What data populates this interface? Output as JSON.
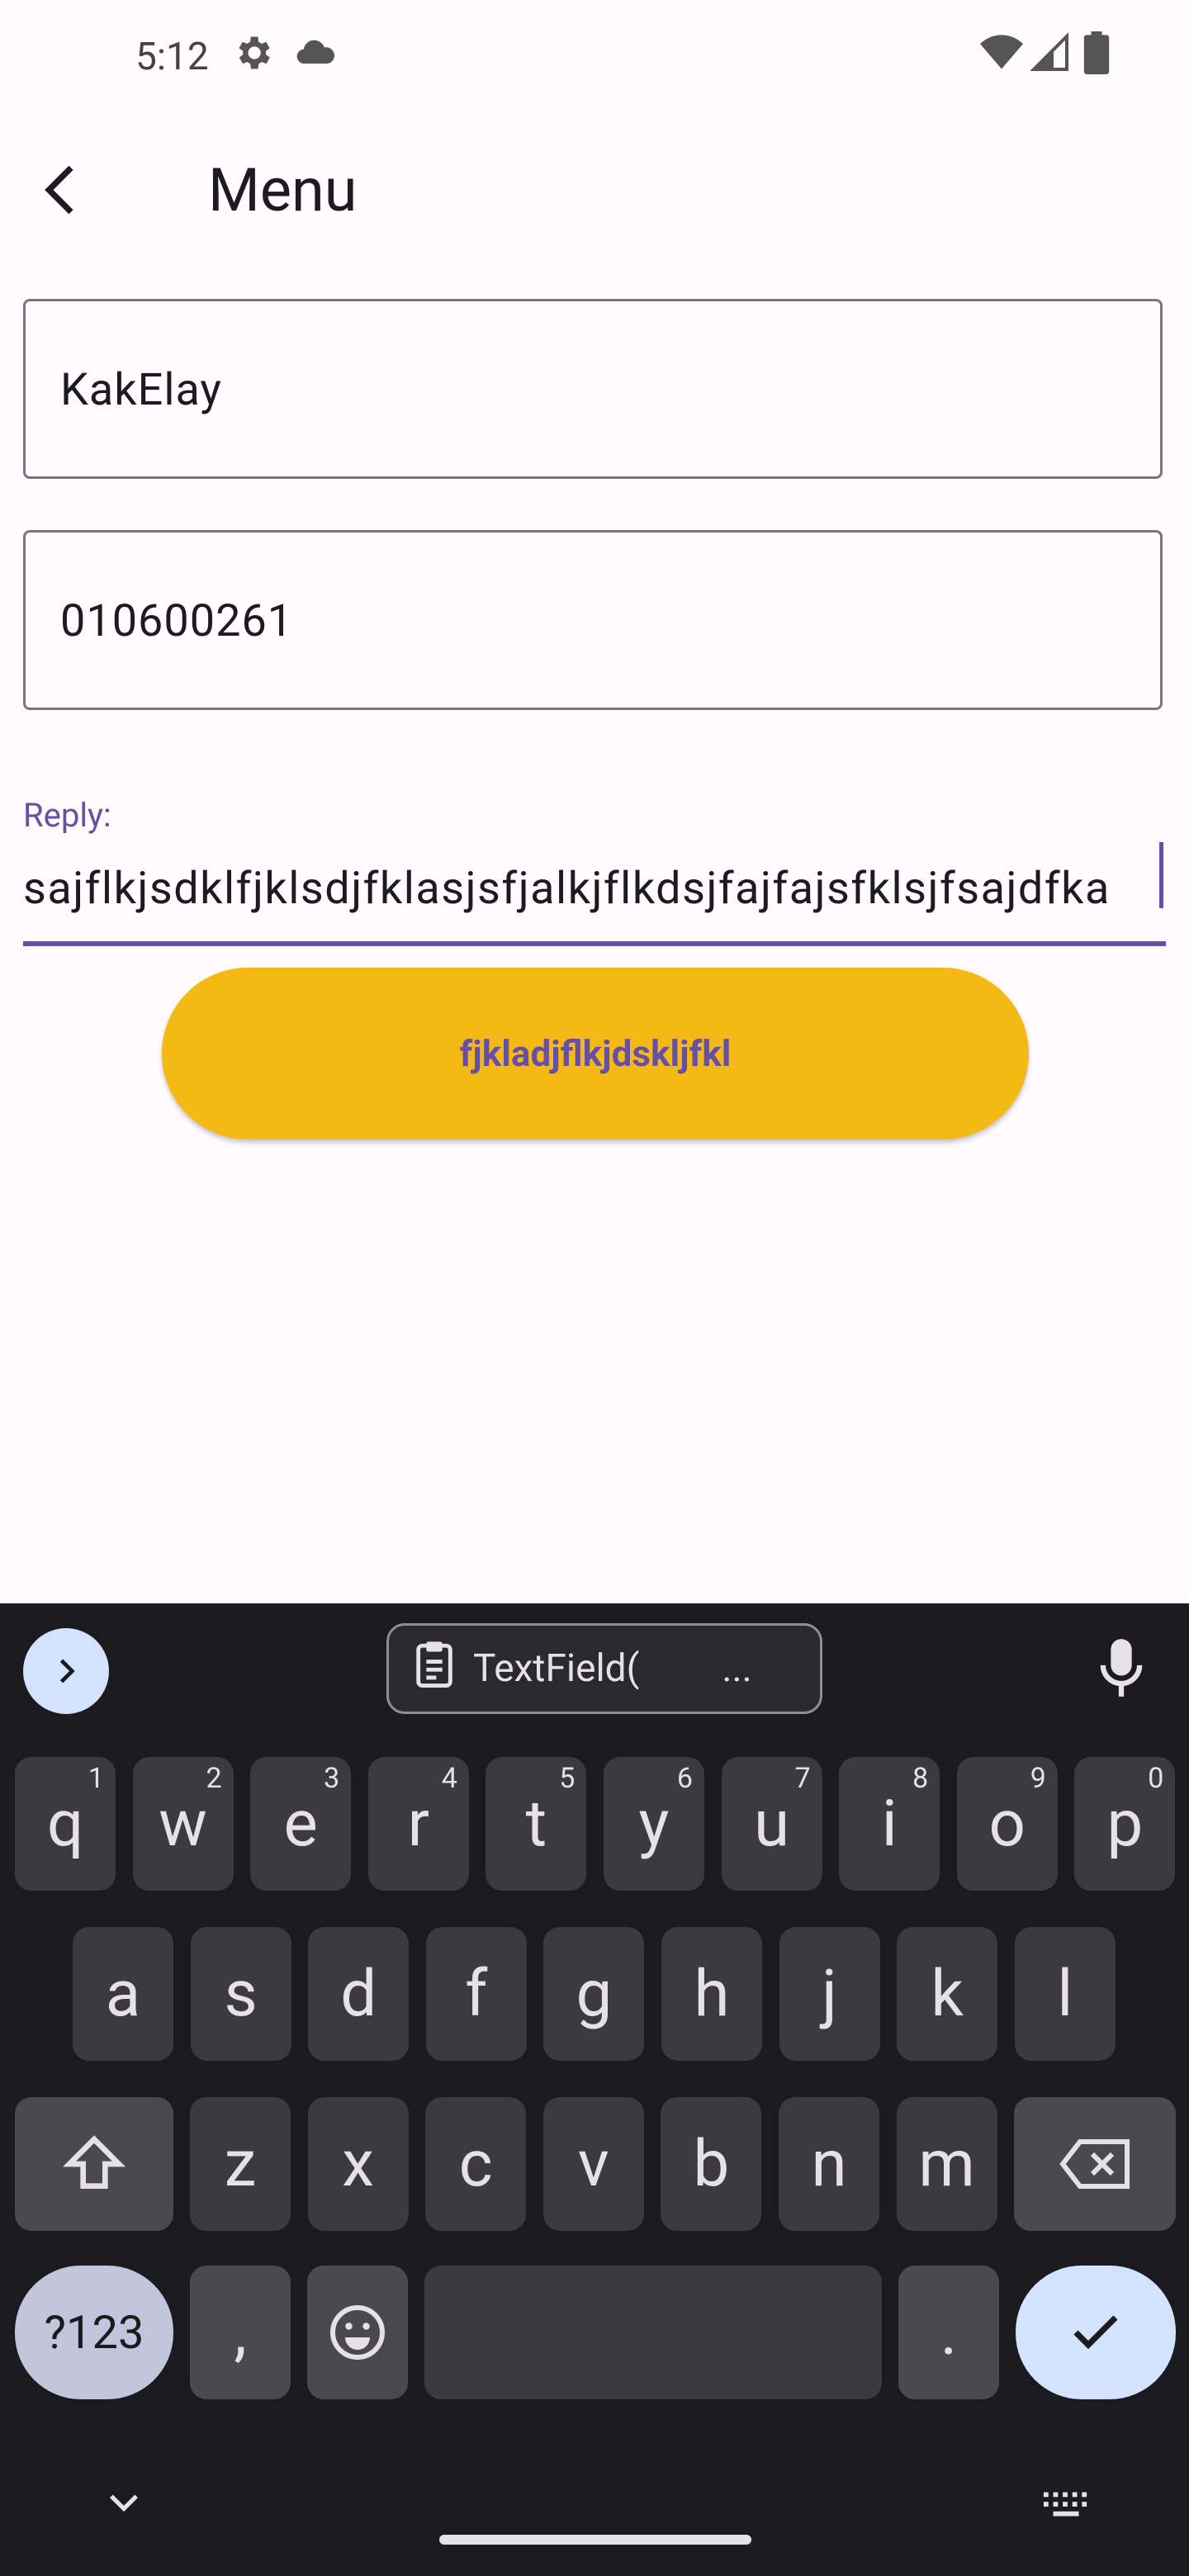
{
  "status_bar": {
    "time": "5:12"
  },
  "app_bar": {
    "title": "Menu"
  },
  "form": {
    "name_value": "KakElay",
    "phone_value": "010600261",
    "reply_label": "Reply:",
    "reply_value": "sajflkjsdklfjklsdjfklasjsfjalkjflkdsjfajfajsfklsjfsajdfka",
    "button_label": "fjkladjflkjdskljfkl"
  },
  "keyboard": {
    "clipboard_text": "TextField(",
    "clipboard_more": "...",
    "row1": [
      {
        "k": "q",
        "h": "1"
      },
      {
        "k": "w",
        "h": "2"
      },
      {
        "k": "e",
        "h": "3"
      },
      {
        "k": "r",
        "h": "4"
      },
      {
        "k": "t",
        "h": "5"
      },
      {
        "k": "y",
        "h": "6"
      },
      {
        "k": "u",
        "h": "7"
      },
      {
        "k": "i",
        "h": "8"
      },
      {
        "k": "o",
        "h": "9"
      },
      {
        "k": "p",
        "h": "0"
      }
    ],
    "row2": [
      "a",
      "s",
      "d",
      "f",
      "g",
      "h",
      "j",
      "k",
      "l"
    ],
    "row3": [
      "z",
      "x",
      "c",
      "v",
      "b",
      "n",
      "m"
    ],
    "symbols_label": "?123",
    "comma_label": ",",
    "period_label": "."
  }
}
